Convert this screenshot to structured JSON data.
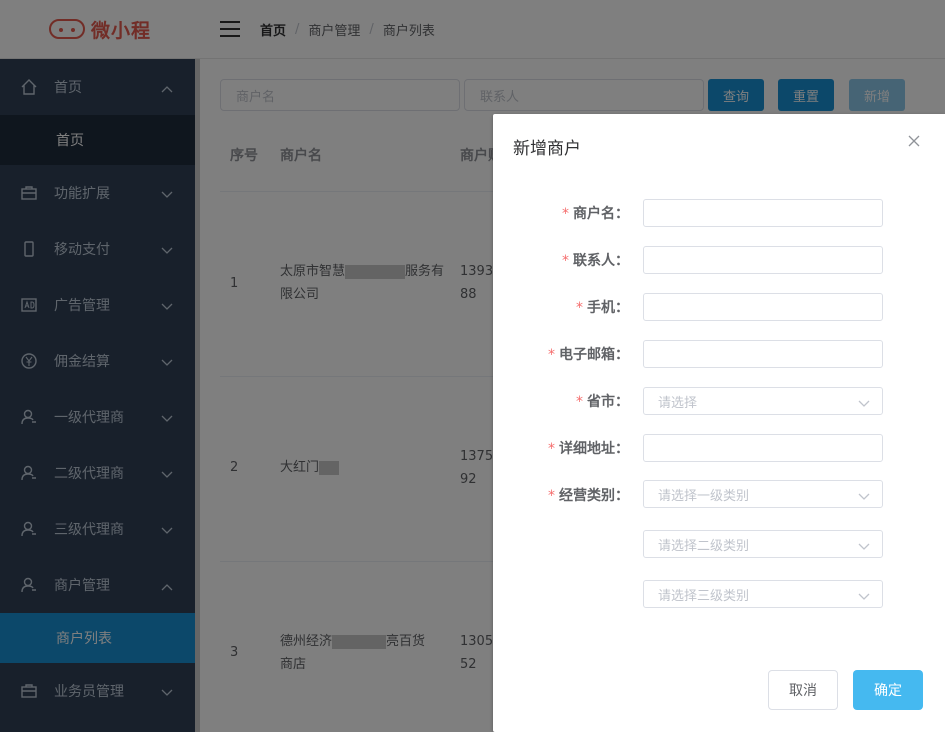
{
  "logo": {
    "text": "微小程"
  },
  "sidebar": {
    "items": [
      {
        "label": "首页",
        "icon": "home-icon",
        "expanded": true
      },
      {
        "label": "功能扩展",
        "icon": "briefcase-icon"
      },
      {
        "label": "移动支付",
        "icon": "phone-icon"
      },
      {
        "label": "广告管理",
        "icon": "ad-icon"
      },
      {
        "label": "佣金结算",
        "icon": "yen-icon"
      },
      {
        "label": "一级代理商",
        "icon": "user-icon"
      },
      {
        "label": "二级代理商",
        "icon": "user-icon"
      },
      {
        "label": "三级代理商",
        "icon": "user-icon"
      },
      {
        "label": "商户管理",
        "icon": "user-icon",
        "expanded": true
      },
      {
        "label": "业务员管理",
        "icon": "briefcase-icon"
      }
    ],
    "subitems": {
      "home": "首页",
      "merchant": "商户列表"
    }
  },
  "breadcrumb": [
    "首页",
    "商户管理",
    "商户列表"
  ],
  "search": {
    "merchant_placeholder": "商户名",
    "contact_placeholder": "联系人",
    "query_label": "查询",
    "reset_label": "重置",
    "add_label": "新增"
  },
  "table": {
    "headers": [
      "序号",
      "商户名",
      "商户账"
    ],
    "rows": [
      {
        "index": "1",
        "name_line1": "太原市智慧",
        "name_line1b": "服务有",
        "name_line2": "限公司",
        "phone_line1": "1393",
        "phone_line2": "88"
      },
      {
        "index": "2",
        "name_line1": "大红门",
        "name_line1b": "",
        "name_line2": "",
        "phone_line1": "1375",
        "phone_line2": "92"
      },
      {
        "index": "3",
        "name_line1": "德州经济",
        "name_line1b": "亮百货",
        "name_line2": "商店",
        "phone_line1": "1305",
        "phone_line2": "52"
      }
    ]
  },
  "dialog": {
    "title": "新增商户",
    "fields": [
      {
        "label": "商户名：",
        "required": "*"
      },
      {
        "label": "联系人：",
        "required": "*"
      },
      {
        "label": "手机：",
        "required": "*"
      },
      {
        "label": "电子邮箱：",
        "required": "*"
      },
      {
        "label": "省市：",
        "required": "*",
        "placeholder": "请选择"
      },
      {
        "label": "详细地址：",
        "required": "*"
      },
      {
        "label": "经营类别：",
        "required": "*",
        "placeholder": "请选择一级类别"
      }
    ],
    "category2_placeholder": "请选择二级类别",
    "category3_placeholder": "请选择三级类别",
    "cancel_label": "取消",
    "ok_label": "确定"
  },
  "colors": {
    "sidebar_bg": "#304156",
    "active": "#1890d5",
    "primary_button": "#45b9f0",
    "required": "#f56c6c",
    "logo": "#e45b4f"
  }
}
